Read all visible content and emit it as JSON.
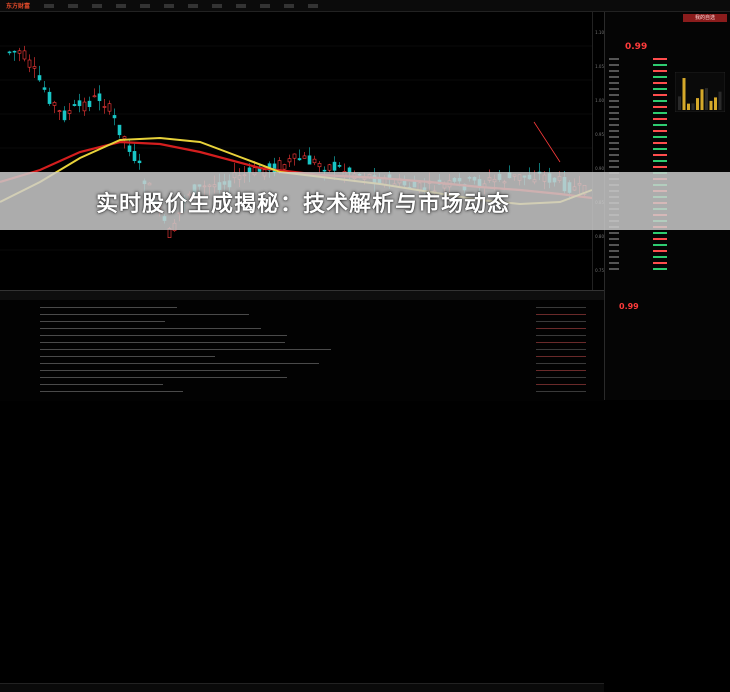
{
  "app": {
    "logo_text": "东方财富",
    "menu_items": [
      "",
      "",
      "",
      "",
      "",
      "",
      "",
      "",
      "",
      "",
      "",
      "",
      "",
      ""
    ]
  },
  "chart": {
    "yaxis_ticks": [
      "1.10",
      "1.05",
      "1.00",
      "0.95",
      "0.90",
      "0.85",
      "0.80",
      "0.75"
    ],
    "colors": {
      "up": "#ff3b3b",
      "down": "#18c6c6",
      "ma_short": "#e8d23a",
      "ma_long": "#d41e1e"
    }
  },
  "right_panel": {
    "header": "我的自选",
    "code": "",
    "price": "0.99",
    "pct": "",
    "price_bottom": "0.99"
  },
  "bottom": {
    "tabs": [
      "",
      "",
      "",
      "",
      "",
      "",
      "",
      "",
      "",
      "",
      ""
    ]
  },
  "banner": {
    "title": "实时股价生成揭秘：技术解析与市场动态"
  }
}
